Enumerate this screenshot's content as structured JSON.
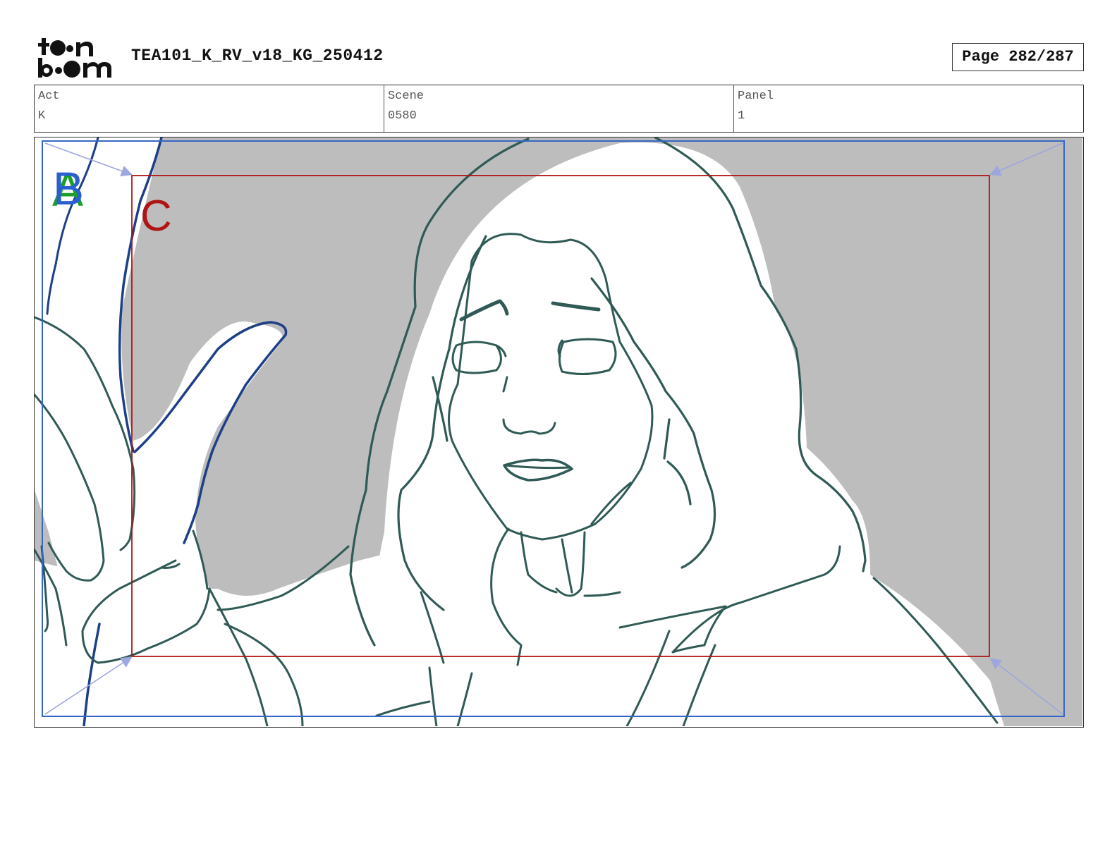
{
  "header": {
    "logo_text_top": "toon",
    "logo_text_bottom": "boom",
    "doc_title": "TEA101_K_RV_v18_KG_250412",
    "page_label": "Page 282/287"
  },
  "info": {
    "act_label": "Act",
    "act_value": "K",
    "scene_label": "Scene",
    "scene_value": "0580",
    "panel_label": "Panel",
    "panel_value": "1"
  },
  "panel": {
    "frame_marks": [
      "B",
      "A",
      "C"
    ],
    "colors": {
      "background_gray": "#bdbdbd",
      "line": "#2f5a55",
      "hand_line": "#1d3f86",
      "frame_blue": "#3566c4",
      "frame_red": "#b01515",
      "mark_green": "#1aa02a",
      "mark_blue": "#2b5fd0",
      "mark_red": "#b01515",
      "arrow": "#9ea6de"
    }
  }
}
